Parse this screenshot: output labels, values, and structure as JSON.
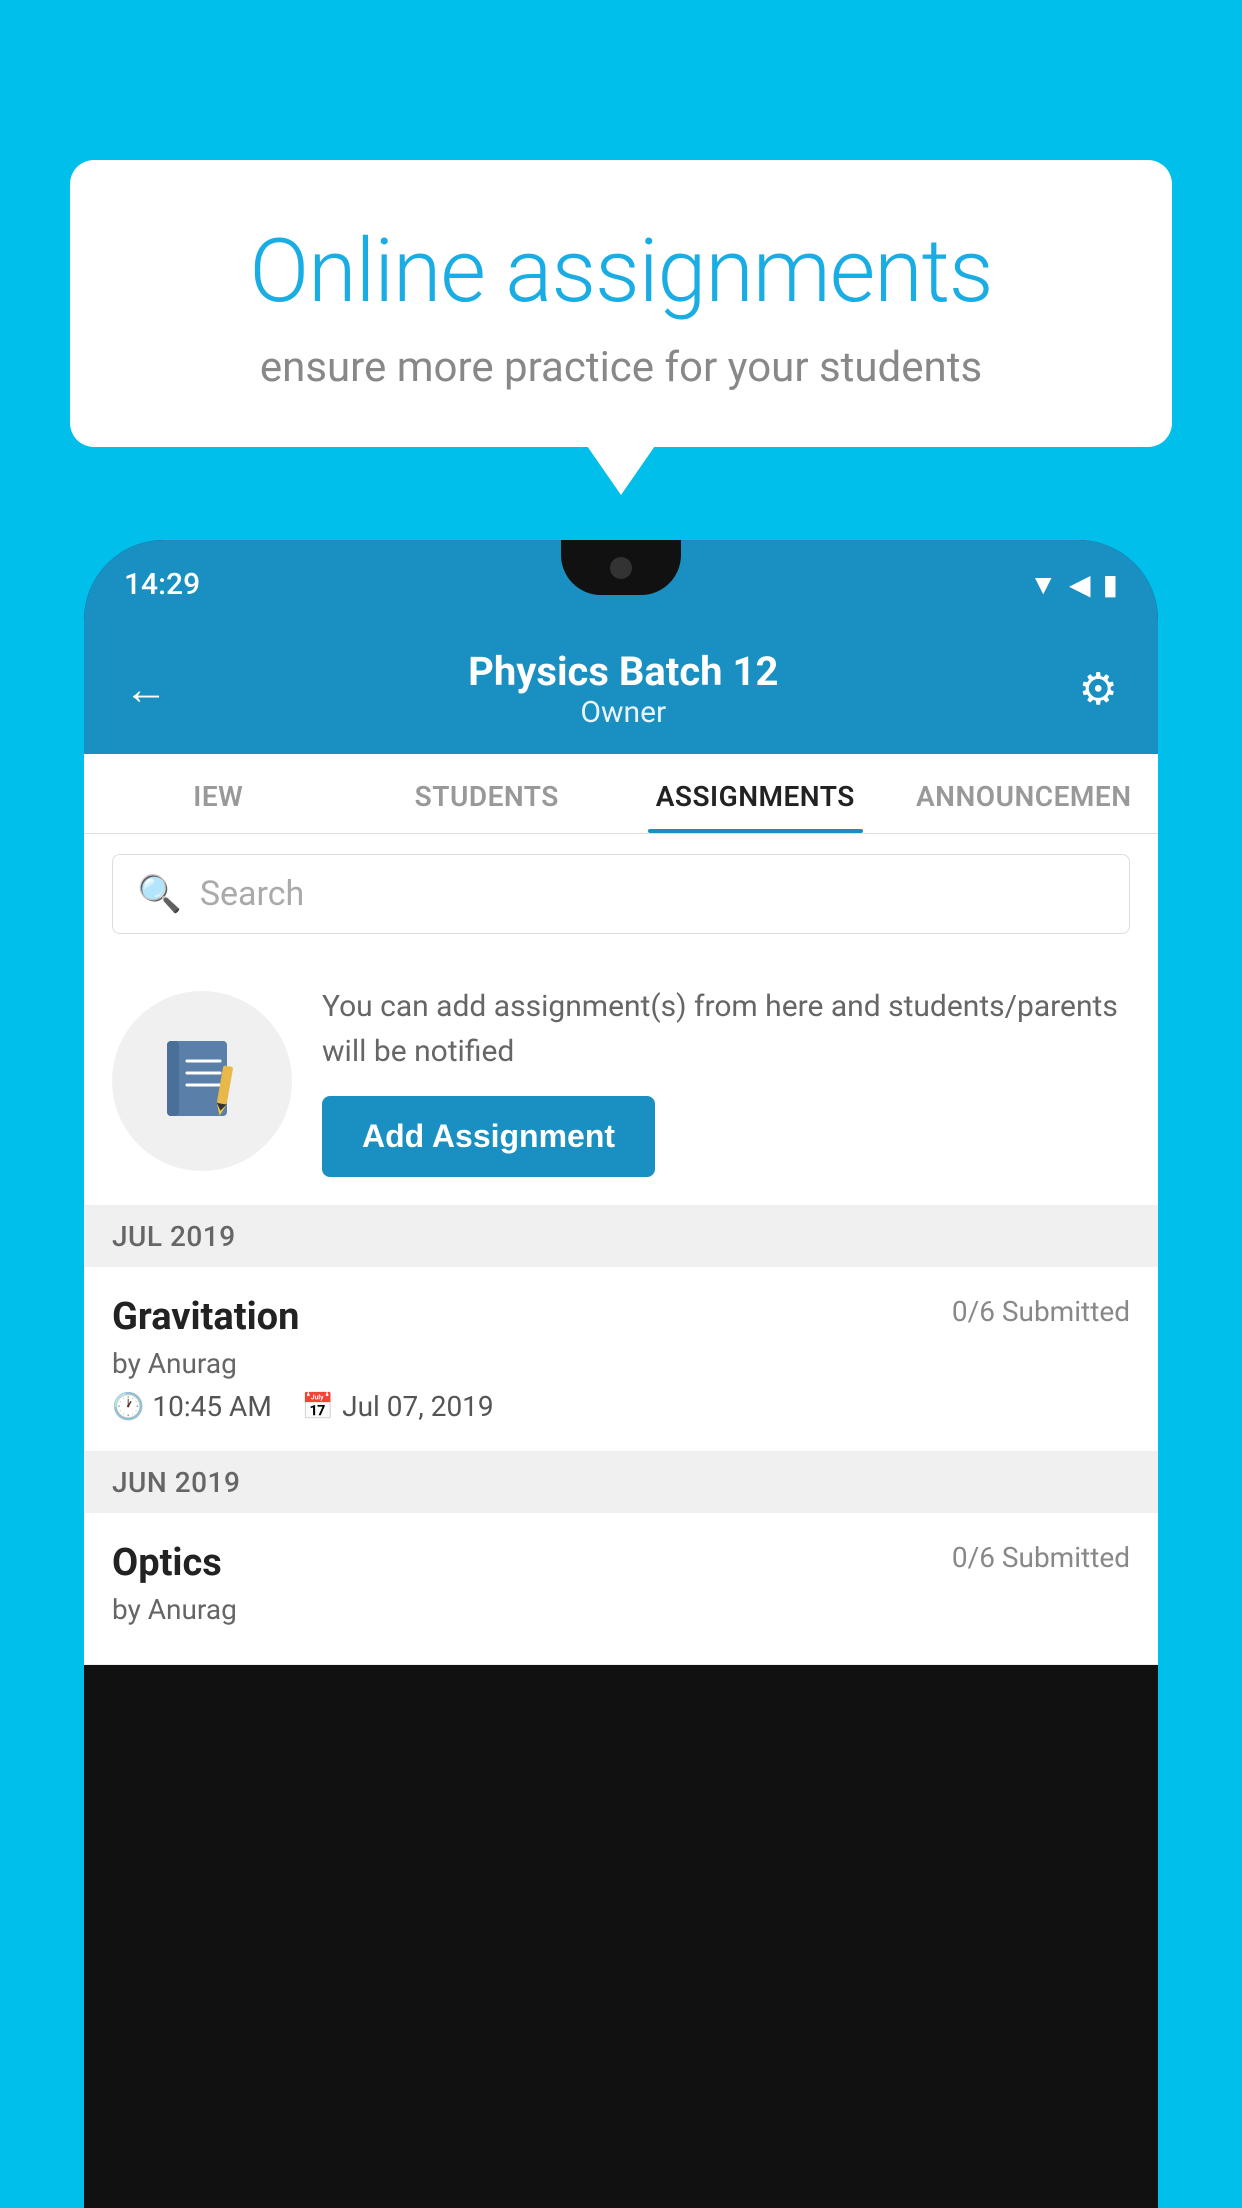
{
  "background_color": "#00BFEA",
  "bubble": {
    "title": "Online assignments",
    "subtitle": "ensure more practice for your students"
  },
  "phone": {
    "status_time": "14:29",
    "header": {
      "title": "Physics Batch 12",
      "subtitle": "Owner",
      "back_label": "←",
      "settings_label": "⚙"
    },
    "tabs": [
      {
        "label": "IEW",
        "active": false
      },
      {
        "label": "STUDENTS",
        "active": false
      },
      {
        "label": "ASSIGNMENTS",
        "active": true
      },
      {
        "label": "ANNOUNCEMENTS",
        "active": false
      }
    ],
    "search": {
      "placeholder": "Search"
    },
    "promo": {
      "text": "You can add assignment(s) from here and students/parents will be notified",
      "button_label": "Add Assignment"
    },
    "sections": [
      {
        "header": "JUL 2019",
        "items": [
          {
            "name": "Gravitation",
            "submitted": "0/6 Submitted",
            "by": "by Anurag",
            "time": "10:45 AM",
            "date": "Jul 07, 2019"
          }
        ]
      },
      {
        "header": "JUN 2019",
        "items": [
          {
            "name": "Optics",
            "submitted": "0/6 Submitted",
            "by": "by Anurag",
            "time": "",
            "date": ""
          }
        ]
      }
    ]
  }
}
